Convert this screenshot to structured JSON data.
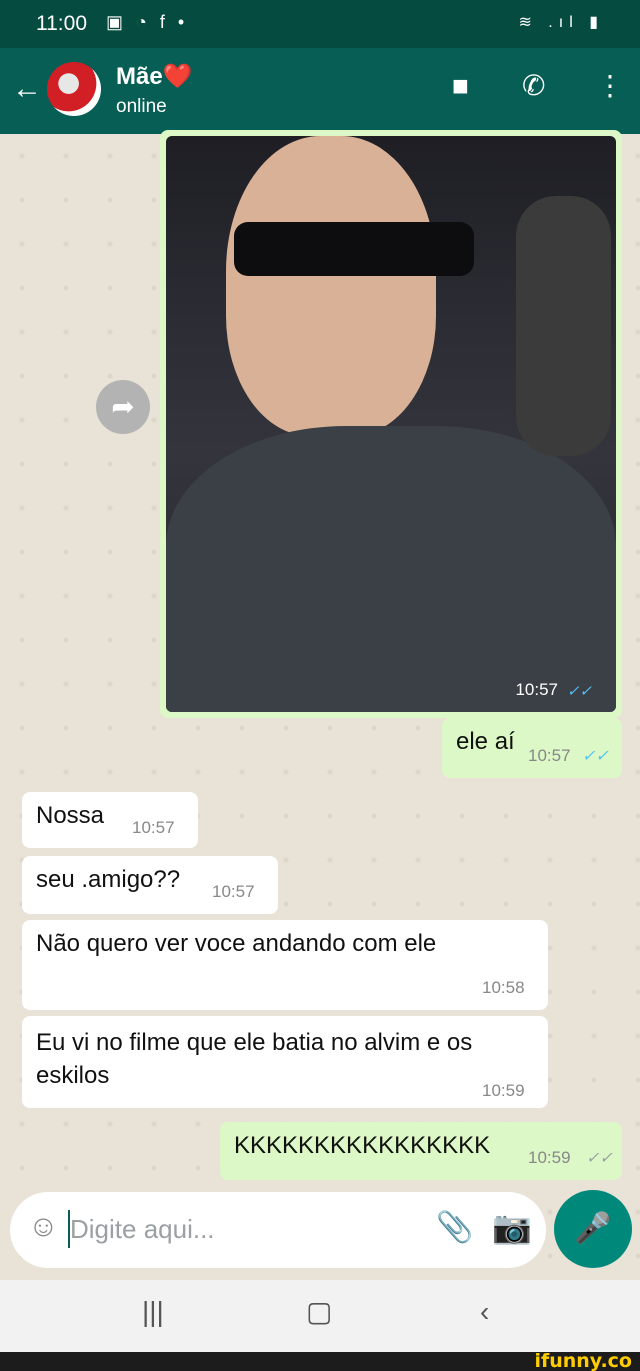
{
  "status_bar": {
    "time": "11:00",
    "notifications": "▣ ◔ f •",
    "right_icons": "≋ .ıl ▮"
  },
  "header": {
    "back_icon": "←",
    "contact_name": "Mãe❤️",
    "contact_status": "online",
    "video_icon": "■",
    "call_icon": "✆",
    "menu_icon": "⋮"
  },
  "messages": [
    {
      "type": "image",
      "direction": "out",
      "time": "10:57",
      "ticks": "✓✓",
      "read": true
    },
    {
      "type": "text",
      "direction": "out",
      "text": "ele aí",
      "time": "10:57",
      "ticks": "✓✓",
      "read": true
    },
    {
      "type": "text",
      "direction": "in",
      "text": "Nossa",
      "time": "10:57"
    },
    {
      "type": "text",
      "direction": "in",
      "text": "seu .amigo??",
      "time": "10:57"
    },
    {
      "type": "text",
      "direction": "in",
      "text": "Não quero ver voce andando com ele",
      "time": "10:58"
    },
    {
      "type": "text",
      "direction": "in",
      "text": "Eu vi no filme que ele batia no alvim e os eskilos",
      "time": "10:59"
    },
    {
      "type": "text",
      "direction": "out",
      "text": "KKKKKKKKKKKKKKKK",
      "time": "10:59",
      "ticks": "✓✓",
      "read": false
    }
  ],
  "forward_icon": "➦",
  "composer": {
    "emoji_icon": "☺",
    "placeholder": "Digite aqui...",
    "attach_icon": "📎",
    "camera_icon": "📷",
    "mic_icon": "🎤"
  },
  "nav": {
    "recent": "|||",
    "home": "▢",
    "back": "‹"
  },
  "watermark": "ifunny.co",
  "colors": {
    "header": "#075e54",
    "status_bar": "#054b3f",
    "outgoing": "#dcf8c6",
    "incoming": "#ffffff",
    "read_ticks": "#4fc3f7",
    "accent": "#00897b"
  }
}
